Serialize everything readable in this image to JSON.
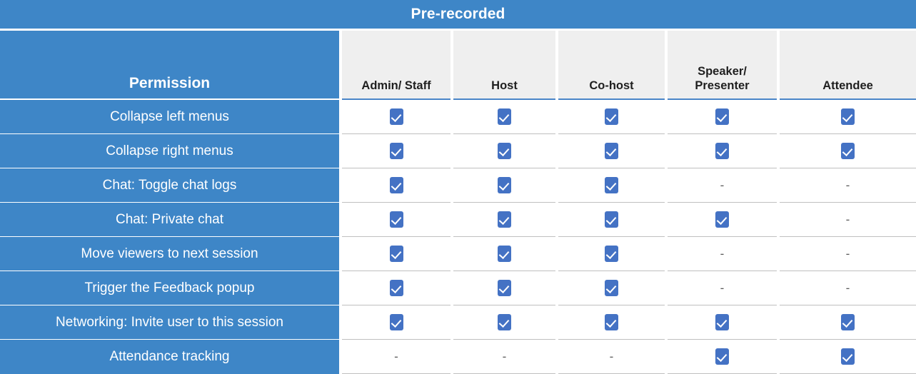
{
  "table": {
    "title": "Pre-recorded",
    "permission_header": "Permission",
    "columns": [
      "Admin/ Staff",
      "Host",
      "Co-host",
      "Speaker/\nPresenter",
      "Attendee"
    ],
    "symbols": {
      "allowed": "checkmark-icon",
      "not_allowed": "-"
    },
    "colors": {
      "header_blue": "#3E86C7",
      "column_header_gray": "#EFEFEF",
      "checkbox_blue": "#4472C4",
      "row_divider": "#BFBFBF",
      "text_light": "#FFFFFF",
      "text_dark": "#1F1F1F",
      "dash_gray": "#595959"
    },
    "rows": [
      {
        "permission": "Collapse left menus",
        "values": [
          "check",
          "check",
          "check",
          "check",
          "check"
        ]
      },
      {
        "permission": "Collapse right menus",
        "values": [
          "check",
          "check",
          "check",
          "check",
          "check"
        ]
      },
      {
        "permission": "Chat: Toggle chat logs",
        "values": [
          "check",
          "check",
          "check",
          "dash",
          "dash"
        ]
      },
      {
        "permission": "Chat: Private chat",
        "values": [
          "check",
          "check",
          "check",
          "check",
          "dash"
        ]
      },
      {
        "permission": "Move viewers to next session",
        "values": [
          "check",
          "check",
          "check",
          "dash",
          "dash"
        ]
      },
      {
        "permission": "Trigger the Feedback popup",
        "values": [
          "check",
          "check",
          "check",
          "dash",
          "dash"
        ]
      },
      {
        "permission": "Networking: Invite user to this session",
        "values": [
          "check",
          "check",
          "check",
          "check",
          "check"
        ]
      },
      {
        "permission": "Attendance tracking",
        "values": [
          "dash",
          "dash",
          "dash",
          "check",
          "check"
        ]
      }
    ]
  }
}
